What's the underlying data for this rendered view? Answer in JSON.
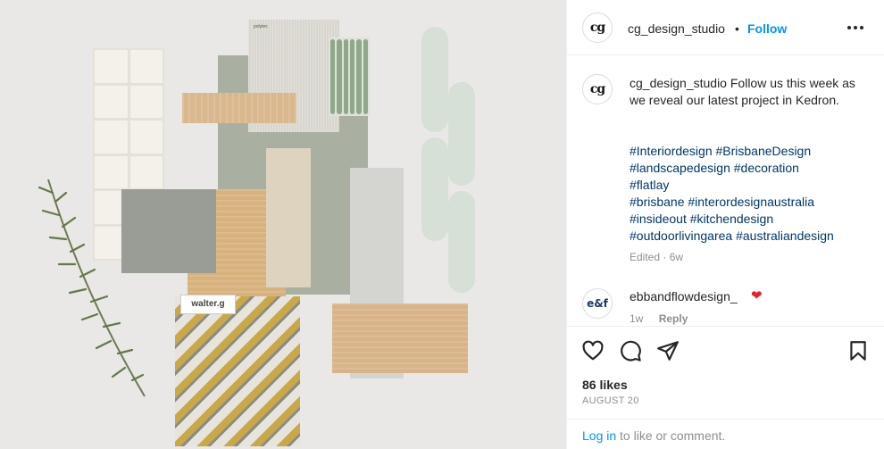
{
  "post": {
    "username": "cg_design_studio",
    "avatar_text": "cg",
    "follow_label": "Follow",
    "separator": "•",
    "more_icon": "more-horizontal-icon",
    "caption_text": "Follow us this week as we reveal our latest project in Kedron.",
    "hashtags": [
      "#Interiordesign #BrisbaneDesign",
      "#landscapedesign #decoration",
      "#flatlay",
      "#brisbane #interordesignaustralia",
      "#insideout #kitchendesign",
      "#outdoorlivingarea #australiandesign"
    ],
    "edited_label": "Edited · 6w"
  },
  "comment": {
    "avatar_text": "e&f",
    "username": "ebbandflowdesign_",
    "heart": "❤",
    "time": "1w",
    "reply_label": "Reply"
  },
  "actions": {
    "icons": [
      "heart-icon",
      "comment-icon",
      "share-icon",
      "bookmark-icon"
    ]
  },
  "stats": {
    "likes": "86 likes",
    "date": "AUGUST 20"
  },
  "login": {
    "link": "Log in",
    "text": "to like or comment."
  },
  "photo": {
    "alt_label": "walter.g",
    "sample_label": "polytec"
  },
  "colors": {
    "accent": "#0095f6",
    "hashtag": "#00376b",
    "muted": "#8e8e8e",
    "heart": "#ed1c2e"
  }
}
